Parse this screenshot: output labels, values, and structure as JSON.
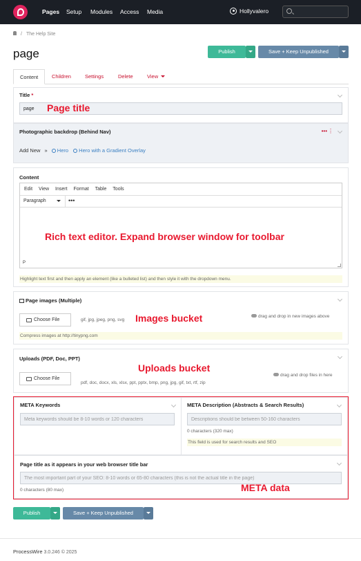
{
  "topnav": {
    "items": [
      "Pages",
      "Setup",
      "Modules",
      "Access",
      "Media"
    ],
    "user": "Hollyvalero"
  },
  "breadcrumb": {
    "site": "The Help Site"
  },
  "page": {
    "title": "page"
  },
  "actions": {
    "publish": "Publish",
    "save_keep": "Save + Keep Unpublished"
  },
  "tabs": [
    "Content",
    "Children",
    "Settings",
    "Delete",
    "View"
  ],
  "fields": {
    "title": {
      "label": "Title",
      "required": "*",
      "value": "page",
      "annotation": "Page title"
    },
    "backdrop": {
      "label": "Photographic backdrop (Behind Nav)",
      "add_new": "Add New",
      "option1": "Hero",
      "option2": "Hero with a Gradient Overlay"
    },
    "content": {
      "label": "Content",
      "menu": [
        "Edit",
        "View",
        "Insert",
        "Format",
        "Table",
        "Tools"
      ],
      "format": "Paragraph",
      "more": "•••",
      "status": "P",
      "note": "Highlight text first and then apply an element (like a bulleted list) and then style it with the dropdown menu.",
      "annotation": "Rich text editor. Expand browser window for toolbar"
    },
    "images": {
      "label": "Page images (Multiple)",
      "choose": "Choose File",
      "types": "gif, jpg, jpeg, png, svg",
      "drop": "drag and drop in new images above",
      "note": "Compress images at http://tinypng.com",
      "annotation": "Images bucket"
    },
    "uploads": {
      "label": "Uploads (PDF, Doc, PPT)",
      "choose": "Choose File",
      "types": "pdf, doc, docx, xls, xlsx, ppt, pptx, bmp, png, jpg, gif, txt, rtf, zip",
      "drop": "drag and drop files in here",
      "annotation": "Uploads bucket"
    },
    "meta_keywords": {
      "label": "META Keywords",
      "placeholder": "Meta keywords should be 8-10 words or 120 characters"
    },
    "meta_description": {
      "label": "META Description (Abstracts & Search Results)",
      "placeholder": "Descriptions should be between 50-160 characters",
      "count": "0 characters (320 max)",
      "note": "This field is used for search results and SEO"
    },
    "browser_title": {
      "label": "Page title as it appears in your web browser title bar",
      "placeholder": "The most important part of your SEO: 8-10 words or 65-80 characters (this is not the actual title in the page)",
      "count": "0 characters (80 max)"
    },
    "meta_annotation": "META data"
  },
  "footer": {
    "brand": "ProcessWire",
    "version": "3.0.246 © 2025"
  },
  "colors": {
    "nav_bg": "#1b1f26",
    "brand": "#e0245e",
    "publish": "#3eb998",
    "save": "#6789a8",
    "annotation": "#e8182e",
    "link": "#c8102e"
  }
}
